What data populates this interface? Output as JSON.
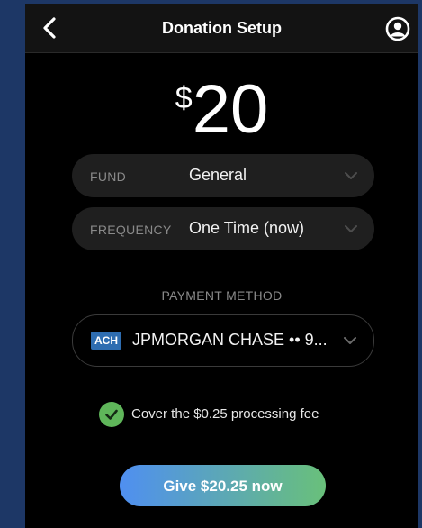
{
  "header": {
    "title": "Donation Setup",
    "back_icon": "chevron-left-icon",
    "profile_icon": "user-circle-icon"
  },
  "amount": {
    "currency_symbol": "$",
    "value": "20"
  },
  "fund": {
    "label": "FUND",
    "value": "General",
    "icon": "chevron-down-icon"
  },
  "frequency": {
    "label": "FREQUENCY",
    "value": "One Time (now)",
    "icon": "chevron-down-icon"
  },
  "payment": {
    "label": "PAYMENT METHOD",
    "badge": "ACH",
    "account": "JPMORGAN CHASE •• 9...",
    "icon": "chevron-down-icon"
  },
  "fee": {
    "checked": true,
    "icon": "check-circle-icon",
    "label": "Cover the $0.25 processing fee"
  },
  "give_button": {
    "label": "Give $20.25 now"
  },
  "colors": {
    "background": "#1d3766",
    "screen": "#000000",
    "pill": "#1f1f1f",
    "ach_badge": "#2e6db1",
    "check": "#5fb65a",
    "button_gradient_start": "#4f8ff1",
    "button_gradient_end": "#69c07a"
  }
}
